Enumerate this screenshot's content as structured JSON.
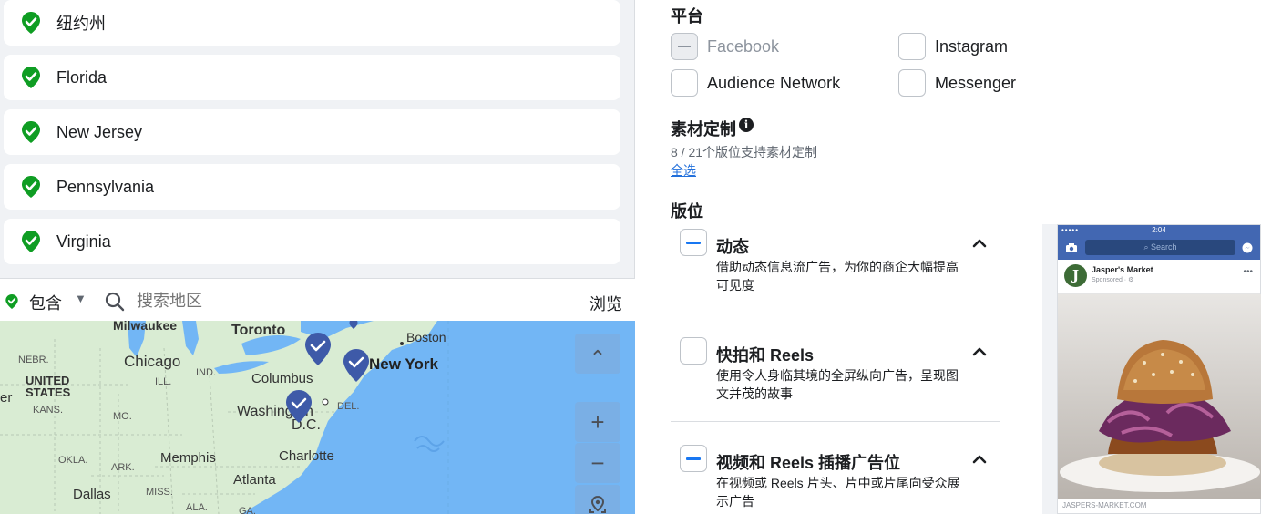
{
  "locations": [
    {
      "name": "纽约州"
    },
    {
      "name": "Florida"
    },
    {
      "name": "New Jersey"
    },
    {
      "name": "Pennsylvania"
    },
    {
      "name": "Virginia"
    }
  ],
  "location_search": {
    "include_label": "包含",
    "placeholder": "搜索地区",
    "browse_label": "浏览"
  },
  "map": {
    "labels": [
      "Milwaukee",
      "Toronto",
      "Boston",
      "Chicago",
      "New York",
      "NEBR.",
      "IND.",
      "Columbus",
      "UNITED",
      "STATES",
      "ILL.",
      "KANS.",
      "MO.",
      "Washington",
      "D.C.",
      "DEL.",
      "OKLA.",
      "ARK.",
      "Memphis",
      "Charlotte",
      "Atlanta",
      "Dallas",
      "MISS.",
      "ALA.",
      "GA.",
      "er"
    ],
    "controls": {
      "up": "⌃",
      "zoom_in": "+",
      "zoom_out": "−"
    },
    "colors": {
      "land": "#d9ecd3",
      "water": "#72b6f5",
      "pin": "#3e5aa8",
      "include": "#0f9d23"
    }
  },
  "platforms": {
    "heading": "平台",
    "items": [
      {
        "label": "Facebook",
        "state": "disabled"
      },
      {
        "label": "Instagram",
        "state": "unchecked"
      },
      {
        "label": "Audience Network",
        "state": "unchecked"
      },
      {
        "label": "Messenger",
        "state": "unchecked"
      }
    ]
  },
  "asset_customization": {
    "heading": "素材定制",
    "subtitle": "8 / 21个版位支持素材定制",
    "select_all": "全选"
  },
  "placements": {
    "heading": "版位",
    "groups": [
      {
        "title": "动态",
        "desc": "借助动态信息流广告，为你的商企大幅提高可见度",
        "state": "partial"
      },
      {
        "title": "快拍和 Reels",
        "desc": "使用令人身临其境的全屏纵向广告，呈现图文并茂的故事",
        "state": "unchecked"
      },
      {
        "title": "视频和 Reels 插播广告位",
        "desc": "在视频或 Reels 片头、片中或片尾向受众展示广告",
        "state": "partial"
      }
    ]
  },
  "preview": {
    "time": "2:04",
    "search": "Search",
    "page_name": "Jasper's Market",
    "sponsored": "Sponsored · ⚙",
    "avatar_letter": "J",
    "domain": "JASPERS-MARKET.COM"
  }
}
